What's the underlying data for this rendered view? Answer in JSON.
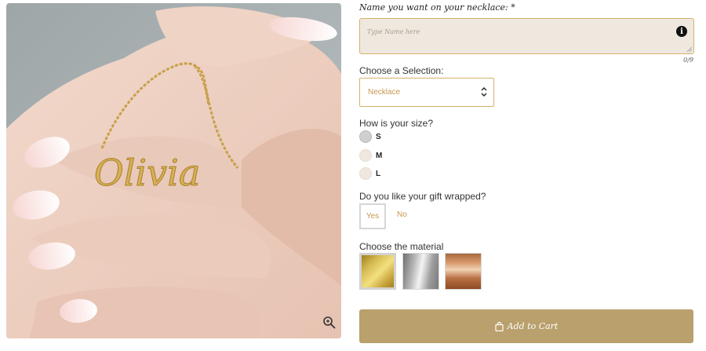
{
  "product_image": {
    "alt": "Hand holding gold name necklace",
    "engraving": "Olivia"
  },
  "name_field": {
    "label": "Name you want on your necklace:",
    "required_mark": "*",
    "placeholder": "Type Name here",
    "value": "",
    "counter": "0/9",
    "info_icon": "info-icon"
  },
  "selection": {
    "label": "Choose a Selection:",
    "value": "Necklace"
  },
  "size": {
    "label": "How is your size?",
    "options": [
      "S",
      "M",
      "L"
    ],
    "selected": "S"
  },
  "gift_wrap": {
    "label": "Do you like your gift wrapped?",
    "yes_label": "Yes",
    "no_label": "No",
    "selected": "Yes"
  },
  "material": {
    "label": "Choose the material",
    "options": [
      {
        "name": "Gold",
        "color": "#d8bd55"
      },
      {
        "name": "Silver",
        "color": "#b8b8b8"
      },
      {
        "name": "Rose Gold",
        "color": "#d7986a"
      }
    ],
    "selected": "Gold"
  },
  "cart": {
    "label": "Add to Cart",
    "icon": "shopping-bag-icon",
    "color": "#b9a06d"
  },
  "colors": {
    "accent": "#c9974e",
    "field_border": "#d7b06e",
    "field_bg": "#efe8df"
  }
}
